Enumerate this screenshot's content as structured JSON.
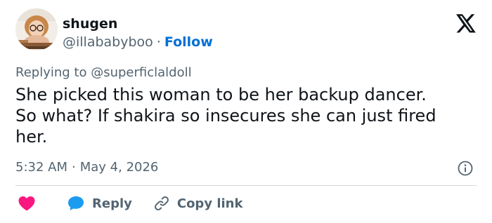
{
  "author": {
    "name": "shugen",
    "handle": "@illababyboo",
    "separator": "·",
    "follow_label": "Follow"
  },
  "reply_context": {
    "prefix": "Replying to",
    "handle": "@superficlaldoll"
  },
  "tweet": {
    "line1": "She picked this woman to be her backup dancer.",
    "line2": "So what? If shakira so insecures she can just fired",
    "line3": "her."
  },
  "meta": {
    "time": "5:32 AM",
    "separator": "·",
    "date": "May 4, 2026"
  },
  "actions": {
    "reply_label": "Reply",
    "copy_link_label": "Copy link"
  },
  "icons": {
    "logo": "x-logo-icon",
    "info": "info-icon",
    "like": "heart-icon",
    "reply": "speech-bubble-icon",
    "link": "link-icon"
  },
  "colors": {
    "text": "#0f1419",
    "secondary": "#536471",
    "link": "#006fd6",
    "like": "#f91880",
    "reply": "#1d9bf0",
    "divider": "#cfd9de"
  }
}
